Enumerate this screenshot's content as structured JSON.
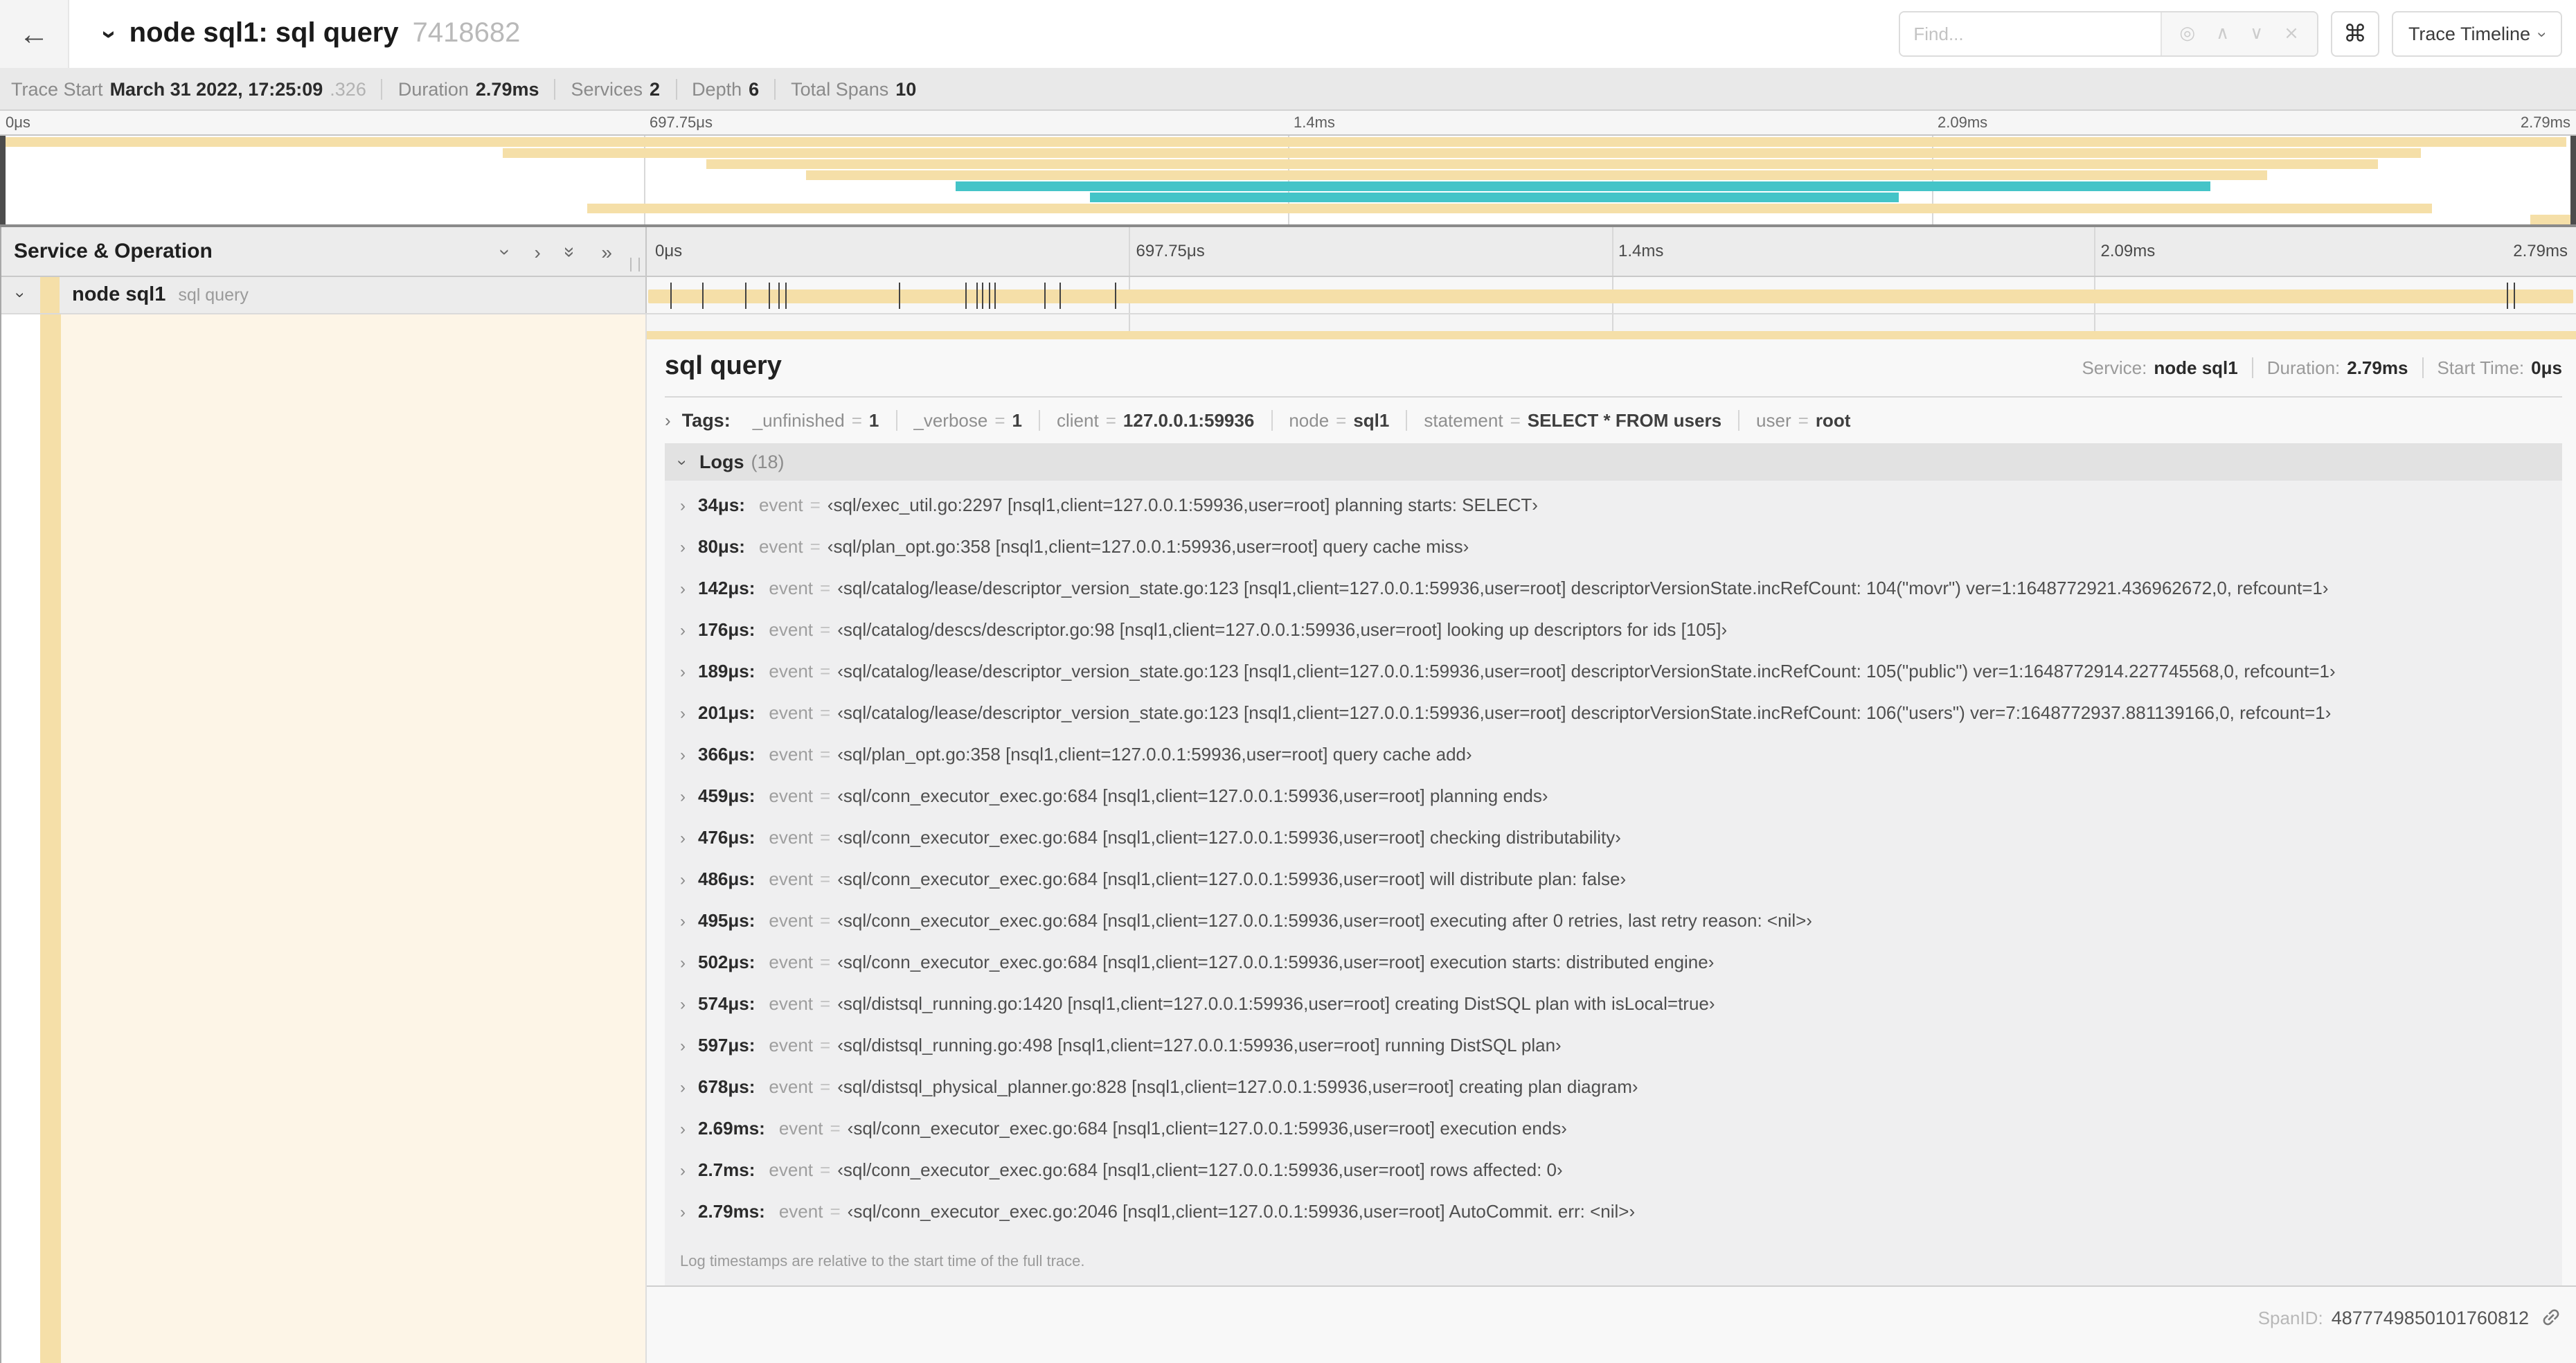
{
  "colors": {
    "tan": "#f5dfa8",
    "teal": "#44c4c8",
    "cream": "#fdf5e7"
  },
  "header": {
    "back_icon": "←",
    "collapse_chevron": "›",
    "title": "node sql1: sql query",
    "trace_id": "7418682",
    "find_placeholder": "Find...",
    "locate_icon": "◎",
    "prev_icon": "∧",
    "next_icon": "∨",
    "clear_icon": "×",
    "shortcuts_icon": "⌘",
    "view_selector": "Trace Timeline",
    "view_caret": "›"
  },
  "summary": {
    "items": [
      {
        "label": "Trace Start",
        "value": "March 31 2022, 17:25:09",
        "suffix": ".326"
      },
      {
        "label": "Duration",
        "value": "2.79ms"
      },
      {
        "label": "Services",
        "value": "2"
      },
      {
        "label": "Depth",
        "value": "6"
      },
      {
        "label": "Total Spans",
        "value": "10"
      }
    ]
  },
  "minimap": {
    "ticks": [
      "0μs",
      "697.75μs",
      "1.4ms",
      "2.09ms",
      "2.79ms"
    ],
    "bars": [
      {
        "start": 0,
        "end": 99.6,
        "color": "tan"
      },
      {
        "start": 19.5,
        "end": 94,
        "color": "tan"
      },
      {
        "start": 27.4,
        "end": 92.3,
        "color": "tan"
      },
      {
        "start": 31.3,
        "end": 88,
        "color": "tan"
      },
      {
        "start": 37.1,
        "end": 85.8,
        "color": "teal"
      },
      {
        "start": 42.3,
        "end": 73.7,
        "color": "teal"
      },
      {
        "start": 22.8,
        "end": 94.4,
        "color": "tan"
      },
      {
        "start": 98.2,
        "end": 99.8,
        "color": "tan"
      }
    ]
  },
  "timeline": {
    "left_header": "Service & Operation",
    "icons": {
      "down": "›",
      "right": "›",
      "double_down": "»",
      "double_right": "»"
    },
    "ticks": [
      "0μs",
      "697.75μs",
      "1.4ms",
      "2.09ms",
      "2.79ms"
    ],
    "span_row": {
      "chevron": "›",
      "service": "node sql1",
      "operation": "sql query",
      "log_markers_pct": [
        1.2,
        2.9,
        5.1,
        6.3,
        6.8,
        7.2,
        13.1,
        16.5,
        17.1,
        17.4,
        17.7,
        18.0,
        20.6,
        21.4,
        24.3,
        96.4,
        96.8
      ]
    }
  },
  "detail": {
    "title": "sql query",
    "meta": [
      {
        "label": "Service:",
        "value": "node sql1"
      },
      {
        "label": "Duration:",
        "value": "2.79ms"
      },
      {
        "label": "Start Time:",
        "value": "0μs"
      }
    ],
    "tags_chevron": "›",
    "tags_label": "Tags:",
    "equals_sign": "=",
    "tags": [
      {
        "key": "_unfinished",
        "value": "1"
      },
      {
        "key": "_verbose",
        "value": "1"
      },
      {
        "key": "client",
        "value": "127.0.0.1:59936"
      },
      {
        "key": "node",
        "value": "sql1"
      },
      {
        "key": "statement",
        "value": "SELECT * FROM users"
      },
      {
        "key": "user",
        "value": "root"
      }
    ],
    "logs_chevron": "›",
    "logs_label": "Logs",
    "logs_count": "(18)",
    "row_chevron": "›",
    "log_key": "event",
    "logs": [
      {
        "time": "34μs:",
        "value": "‹sql/exec_util.go:2297 [nsql1,client=127.0.0.1:59936,user=root] planning starts: SELECT›"
      },
      {
        "time": "80μs:",
        "value": "‹sql/plan_opt.go:358 [nsql1,client=127.0.0.1:59936,user=root] query cache miss›"
      },
      {
        "time": "142μs:",
        "value": "‹sql/catalog/lease/descriptor_version_state.go:123 [nsql1,client=127.0.0.1:59936,user=root] descriptorVersionState.incRefCount: 104(\"movr\") ver=1:1648772921.436962672,0, refcount=1›"
      },
      {
        "time": "176μs:",
        "value": "‹sql/catalog/descs/descriptor.go:98 [nsql1,client=127.0.0.1:59936,user=root] looking up descriptors for ids [105]›"
      },
      {
        "time": "189μs:",
        "value": "‹sql/catalog/lease/descriptor_version_state.go:123 [nsql1,client=127.0.0.1:59936,user=root] descriptorVersionState.incRefCount: 105(\"public\") ver=1:1648772914.227745568,0, refcount=1›"
      },
      {
        "time": "201μs:",
        "value": "‹sql/catalog/lease/descriptor_version_state.go:123 [nsql1,client=127.0.0.1:59936,user=root] descriptorVersionState.incRefCount: 106(\"users\") ver=7:1648772937.881139166,0, refcount=1›"
      },
      {
        "time": "366μs:",
        "value": "‹sql/plan_opt.go:358 [nsql1,client=127.0.0.1:59936,user=root] query cache add›"
      },
      {
        "time": "459μs:",
        "value": "‹sql/conn_executor_exec.go:684 [nsql1,client=127.0.0.1:59936,user=root] planning ends›"
      },
      {
        "time": "476μs:",
        "value": "‹sql/conn_executor_exec.go:684 [nsql1,client=127.0.0.1:59936,user=root] checking distributability›"
      },
      {
        "time": "486μs:",
        "value": "‹sql/conn_executor_exec.go:684 [nsql1,client=127.0.0.1:59936,user=root] will distribute plan: false›"
      },
      {
        "time": "495μs:",
        "value": "‹sql/conn_executor_exec.go:684 [nsql1,client=127.0.0.1:59936,user=root] executing after 0 retries, last retry reason: <nil>›"
      },
      {
        "time": "502μs:",
        "value": "‹sql/conn_executor_exec.go:684 [nsql1,client=127.0.0.1:59936,user=root] execution starts: distributed engine›"
      },
      {
        "time": "574μs:",
        "value": "‹sql/distsql_running.go:1420 [nsql1,client=127.0.0.1:59936,user=root] creating DistSQL plan with isLocal=true›"
      },
      {
        "time": "597μs:",
        "value": "‹sql/distsql_running.go:498 [nsql1,client=127.0.0.1:59936,user=root] running DistSQL plan›"
      },
      {
        "time": "678μs:",
        "value": "‹sql/distsql_physical_planner.go:828 [nsql1,client=127.0.0.1:59936,user=root] creating plan diagram›"
      },
      {
        "time": "2.69ms:",
        "value": "‹sql/conn_executor_exec.go:684 [nsql1,client=127.0.0.1:59936,user=root] execution ends›"
      },
      {
        "time": "2.7ms:",
        "value": "‹sql/conn_executor_exec.go:684 [nsql1,client=127.0.0.1:59936,user=root] rows affected: 0›"
      },
      {
        "time": "2.79ms:",
        "value": "‹sql/conn_executor_exec.go:2046 [nsql1,client=127.0.0.1:59936,user=root] AutoCommit. err: <nil>›"
      }
    ],
    "footer_note": "Log timestamps are relative to the start time of the full trace.",
    "span_id_label": "SpanID:",
    "span_id_value": "4877749850101760812"
  }
}
